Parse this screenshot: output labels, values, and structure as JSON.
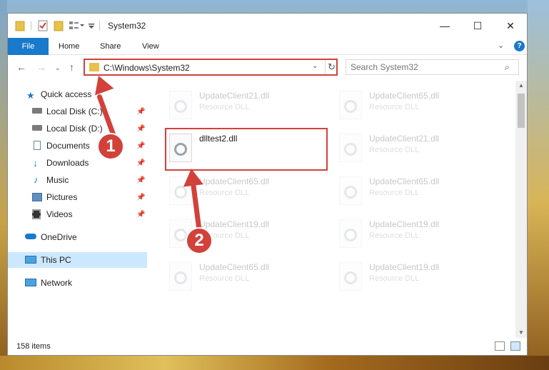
{
  "window": {
    "title": "System32",
    "controls": {
      "minimize": "—",
      "maximize": "☐",
      "close": "✕"
    }
  },
  "ribbon": {
    "tabs": [
      "File",
      "Home",
      "Share",
      "View"
    ],
    "help": "?"
  },
  "address": {
    "path": "C:\\Windows\\System32",
    "search_placeholder": "Search System32"
  },
  "navpane": {
    "quick_access": "Quick access",
    "items": [
      {
        "label": "Local Disk (C:)",
        "icon": "drive-icon",
        "pinned": true
      },
      {
        "label": "Local Disk (D:)",
        "icon": "drive-icon",
        "pinned": true
      },
      {
        "label": "Documents",
        "icon": "documents-icon",
        "pinned": true
      },
      {
        "label": "Downloads",
        "icon": "download-icon",
        "pinned": true
      },
      {
        "label": "Music",
        "icon": "music-icon",
        "pinned": true
      },
      {
        "label": "Pictures",
        "icon": "pictures-icon",
        "pinned": true
      },
      {
        "label": "Videos",
        "icon": "videos-icon",
        "pinned": true
      }
    ],
    "onedrive": "OneDrive",
    "this_pc": "This PC",
    "network": "Network"
  },
  "files": [
    {
      "name": "UpdateClient21.dll",
      "type": "Resource DLL"
    },
    {
      "name": "UpdateClient65.dll",
      "type": "Resource DLL"
    },
    {
      "name": "dlltest2.dll",
      "type": ""
    },
    {
      "name": "UpdateClient21.dll",
      "type": "Resource DLL"
    },
    {
      "name": "UpdateClient65.dll",
      "type": "Resource DLL"
    },
    {
      "name": "UpdateClient65.dll",
      "type": "Resource DLL"
    },
    {
      "name": "UpdateClient19.dll",
      "type": "Resource DLL"
    },
    {
      "name": "UpdateClient19.dll",
      "type": "Resource DLL"
    },
    {
      "name": "UpdateClient65.dll",
      "type": "Resource DLL"
    },
    {
      "name": "UpdateClient19.dll",
      "type": "Resource DLL"
    }
  ],
  "status": {
    "items_count": "158 items"
  },
  "annotations": {
    "marker1": "1",
    "marker2": "2",
    "color": "#d2413a"
  },
  "colors": {
    "accent": "#1979ca",
    "highlight": "#d2413a",
    "selected": "#cce8ff"
  }
}
